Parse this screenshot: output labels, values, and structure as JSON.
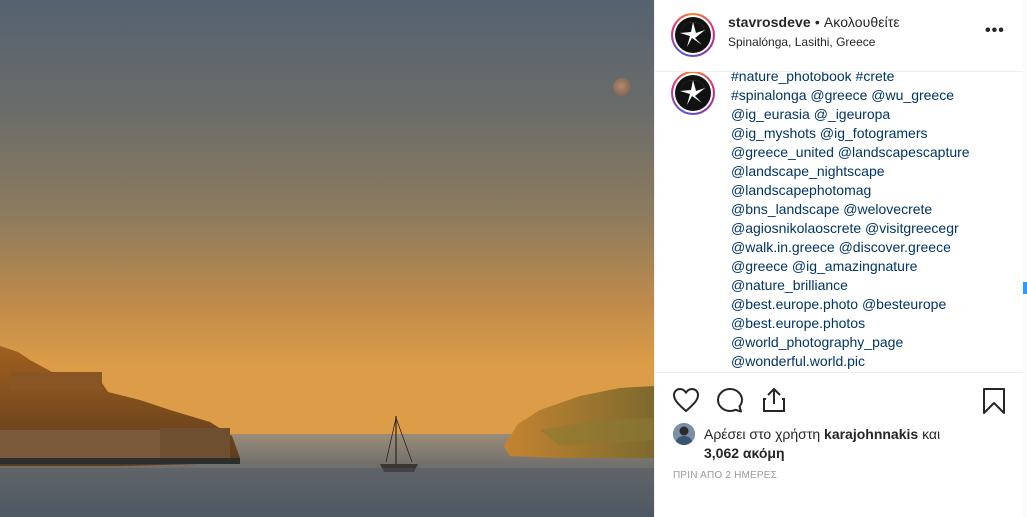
{
  "post": {
    "username": "stavrosdeve",
    "separator": "•",
    "follow_status": "Ακολουθείτε",
    "location": "Spinalónga, Lasithi, Greece",
    "more_label": "•••"
  },
  "caption_lines": [
    "#nature_photobook #crete",
    "#spinalonga @greece @wu_greece",
    "@ig_eurasia @_igeuropa",
    "@ig_myshots @ig_fotogramers",
    "@greece_united @landscapescapture",
    "@landscape_nightscape",
    "@landscapephotomag",
    "@bns_landscape @welovecrete",
    "@agiosnikolaoscrete @visitgreecegr",
    "@walk.in.greece @discover.greece",
    "@greece @ig_amazingnature",
    "@nature_brilliance",
    "@best.europe.photo @besteurope",
    "@best.europe.photos",
    "@world_photography_page",
    "@wonderful.world.pic"
  ],
  "likes": {
    "prefix": "Αρέσει στο χρήστη ",
    "user": "karajohnnakis",
    "middle": " και",
    "count": "3,062",
    "suffix": " ακόμη"
  },
  "timestamp": "ΠΡΙΝ ΑΠΟ 2 ΗΜΕΡΕΣ",
  "icons": {
    "like": "heart-icon",
    "comment": "comment-icon",
    "share": "share-icon",
    "save": "bookmark-icon",
    "more": "more-options-icon"
  },
  "colors": {
    "link": "#003569",
    "text": "#262626",
    "muted": "#999999",
    "sky_top": "#596575",
    "sky_bottom": "#d89a45"
  }
}
